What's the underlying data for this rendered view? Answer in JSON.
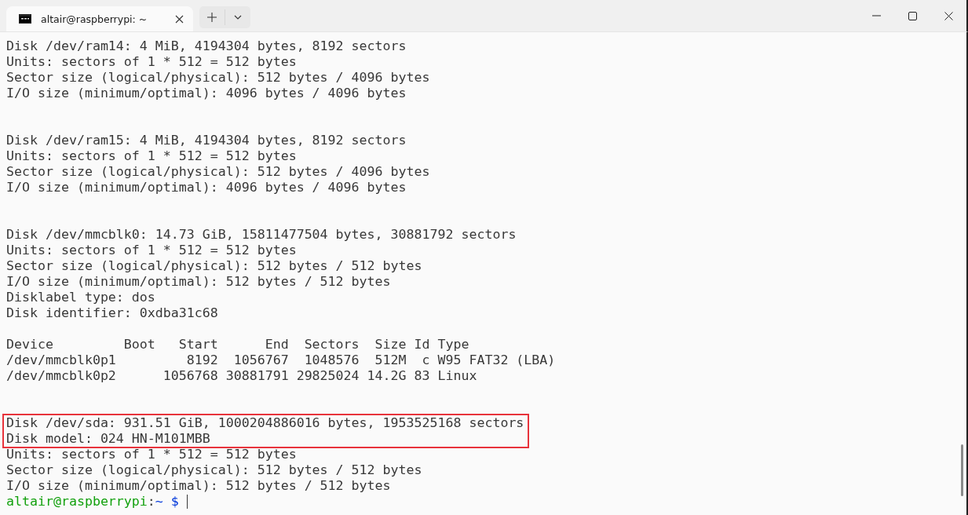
{
  "window": {
    "tab": {
      "title": "altair@raspberrypi: ~",
      "selected": true
    }
  },
  "terminal": {
    "lines": [
      {
        "kind": "text",
        "text": "Disk /dev/ram14: 4 MiB, 4194304 bytes, 8192 sectors"
      },
      {
        "kind": "text",
        "text": "Units: sectors of 1 * 512 = 512 bytes"
      },
      {
        "kind": "text",
        "text": "Sector size (logical/physical): 512 bytes / 4096 bytes"
      },
      {
        "kind": "text",
        "text": "I/O size (minimum/optimal): 4096 bytes / 4096 bytes"
      },
      {
        "kind": "blank"
      },
      {
        "kind": "blank"
      },
      {
        "kind": "text",
        "text": "Disk /dev/ram15: 4 MiB, 4194304 bytes, 8192 sectors"
      },
      {
        "kind": "text",
        "text": "Units: sectors of 1 * 512 = 512 bytes"
      },
      {
        "kind": "text",
        "text": "Sector size (logical/physical): 512 bytes / 4096 bytes"
      },
      {
        "kind": "text",
        "text": "I/O size (minimum/optimal): 4096 bytes / 4096 bytes"
      },
      {
        "kind": "blank"
      },
      {
        "kind": "blank"
      },
      {
        "kind": "text",
        "text": "Disk /dev/mmcblk0: 14.73 GiB, 15811477504 bytes, 30881792 sectors"
      },
      {
        "kind": "text",
        "text": "Units: sectors of 1 * 512 = 512 bytes"
      },
      {
        "kind": "text",
        "text": "Sector size (logical/physical): 512 bytes / 512 bytes"
      },
      {
        "kind": "text",
        "text": "I/O size (minimum/optimal): 512 bytes / 512 bytes"
      },
      {
        "kind": "text",
        "text": "Disklabel type: dos"
      },
      {
        "kind": "text",
        "text": "Disk identifier: 0xdba31c68"
      },
      {
        "kind": "blank"
      },
      {
        "kind": "text",
        "text": "Device         Boot   Start      End  Sectors  Size Id Type"
      },
      {
        "kind": "text",
        "text": "/dev/mmcblk0p1         8192  1056767  1048576  512M  c W95 FAT32 (LBA)"
      },
      {
        "kind": "text",
        "text": "/dev/mmcblk0p2      1056768 30881791 29825024 14.2G 83 Linux"
      },
      {
        "kind": "blank"
      },
      {
        "kind": "blank"
      },
      {
        "kind": "highlight",
        "lines": [
          "Disk /dev/sda: 931.51 GiB, 1000204886016 bytes, 1953525168 sectors",
          "Disk model: 024 HN-M101MBB"
        ]
      },
      {
        "kind": "text",
        "text": "Units: sectors of 1 * 512 = 512 bytes"
      },
      {
        "kind": "text",
        "text": "Sector size (logical/physical): 512 bytes / 512 bytes"
      },
      {
        "kind": "text",
        "text": "I/O size (minimum/optimal): 512 bytes / 512 bytes"
      }
    ],
    "prompt": {
      "user_host": "altair@raspberrypi",
      "separator": ":",
      "path": "~",
      "symbol": "$"
    }
  }
}
